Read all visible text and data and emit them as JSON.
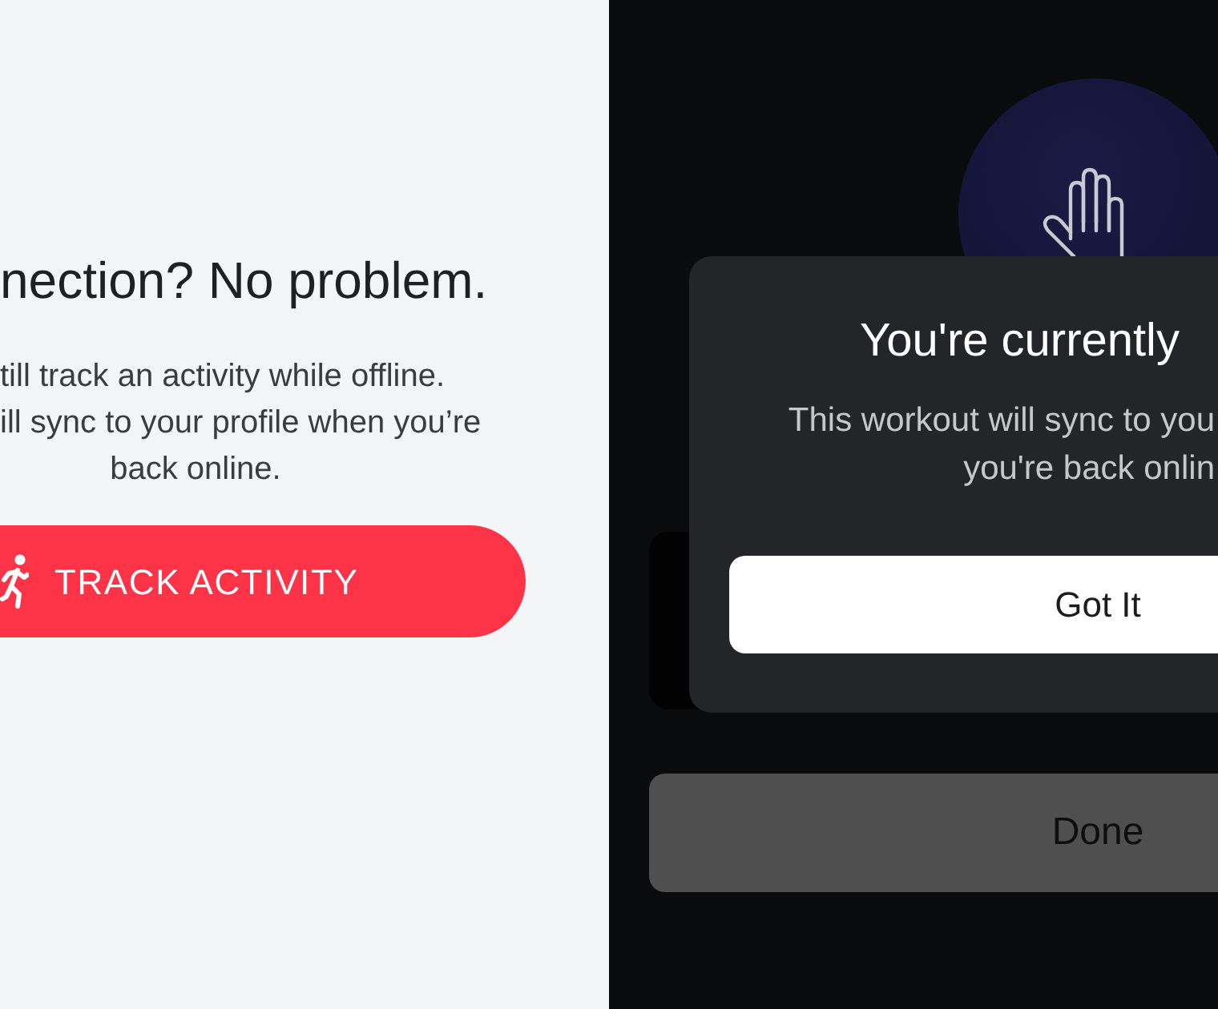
{
  "offline_screen": {
    "title": "nection? No problem.",
    "message_lines": [
      "till track an activity while offline.",
      "ill sync to your profile when you’re",
      "back online."
    ],
    "track_button": {
      "label": "TRACK ACTIVITY"
    }
  },
  "workout_screen": {
    "done_button": {
      "label": "Done"
    }
  },
  "alert": {
    "title": "You're currently",
    "message_lines": [
      "This workout will sync to you",
      "you're back onlin"
    ],
    "confirm_button": {
      "label": "Got It"
    }
  }
}
